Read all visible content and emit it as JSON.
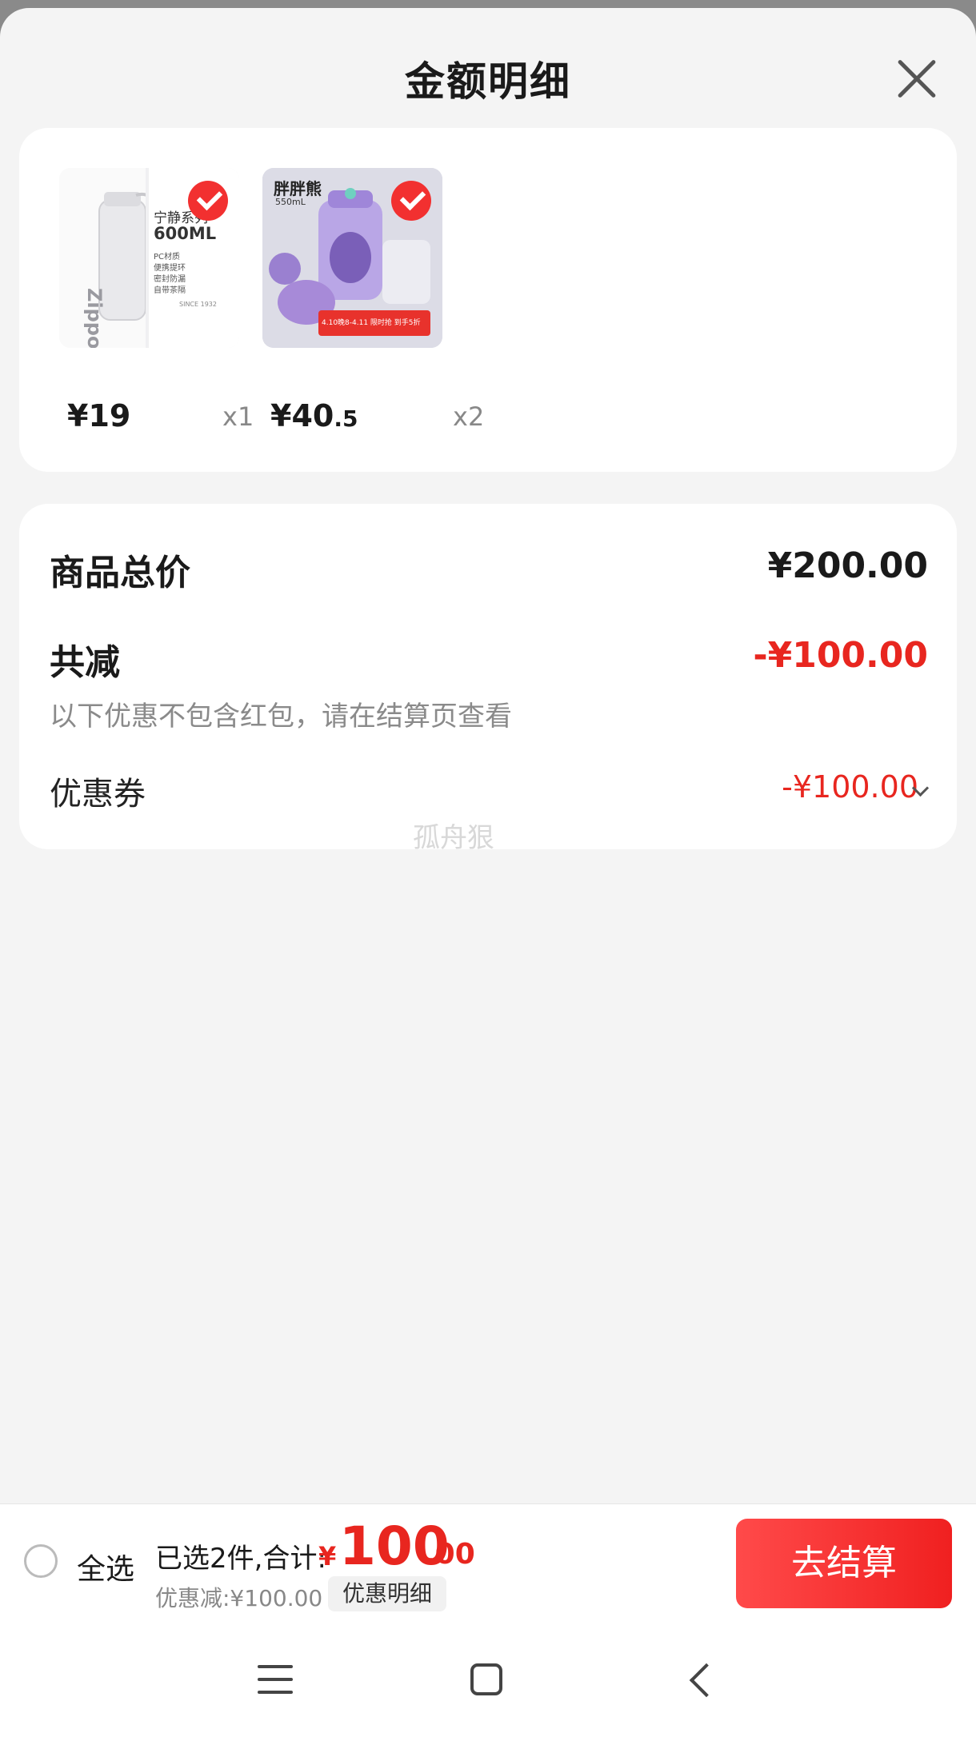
{
  "sheet": {
    "title": "金额明细"
  },
  "products": [
    {
      "price_main": "¥19",
      "price_decimal": "",
      "qty": "x1",
      "image_text": {
        "brand": "Zippo",
        "title": "宁静系列",
        "volume": "600ML",
        "features": [
          "PC材质",
          "便携提环",
          "密封防漏",
          "自带茶隔"
        ],
        "since": "SINCE 1932"
      }
    },
    {
      "price_main": "¥40",
      "price_decimal": ".5",
      "qty": "x2",
      "image_text": {
        "brand": "胖胖熊",
        "volume": "550mL",
        "promo": "4.10晚8-4.11 限时抢 到手5折"
      }
    }
  ],
  "summary": {
    "total_label": "商品总价",
    "total_value": "¥200.00",
    "reduce_label": "共减",
    "reduce_value": "-¥100.00",
    "note": "以下优惠不包含红包，请在结算页查看",
    "coupon_label": "优惠券",
    "coupon_value": "-¥100.00"
  },
  "watermark": "孤舟狠",
  "checkout": {
    "select_all": "全选",
    "selected_summary": "已选2件,合计:",
    "total_currency": "¥",
    "total_int": "100",
    "total_dec": ".00",
    "discount": "优惠减:¥100.00",
    "detail_button": "优惠明细",
    "checkout_button": "去结算"
  },
  "colors": {
    "accent_red": "#e8261f",
    "button_red": "#f23030",
    "sheet_bg": "#f4f4f4"
  }
}
